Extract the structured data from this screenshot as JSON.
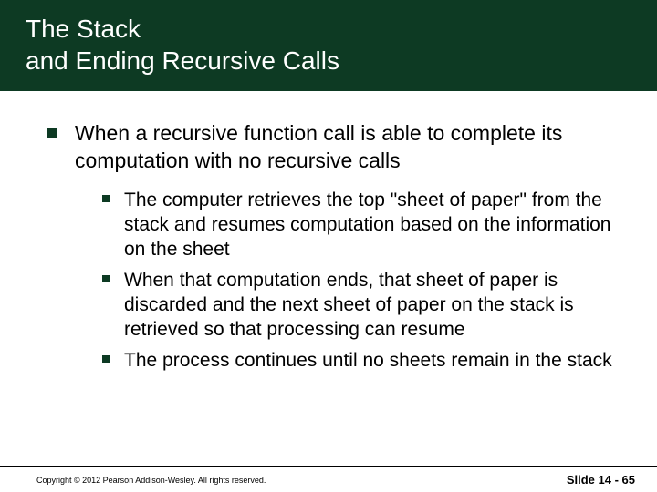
{
  "title": {
    "line1": "The Stack",
    "line2": "and Ending Recursive Calls"
  },
  "main_bullet": "When a recursive function call is able to complete its computation with no recursive calls",
  "sub_bullets": [
    "The computer retrieves the top \"sheet of paper\" from the stack and resumes computation based on the information on the sheet",
    "When that computation ends, that sheet of paper is discarded and the next sheet of paper on the stack is retrieved so that processing can resume",
    "The process continues until no sheets remain in the stack"
  ],
  "footer": {
    "copyright": "Copyright © 2012 Pearson Addison-Wesley. All rights reserved.",
    "slide": "Slide 14 - 65"
  }
}
